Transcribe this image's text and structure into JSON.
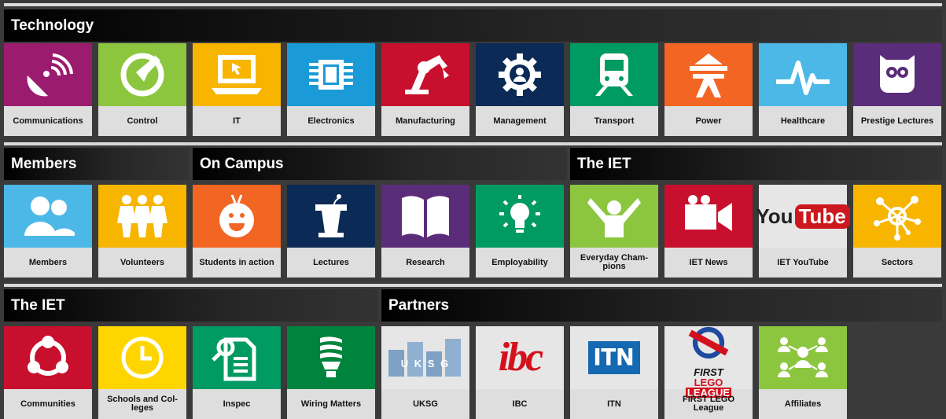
{
  "rows": [
    {
      "sections": [
        {
          "title": "Technology"
        }
      ],
      "tiles": [
        {
          "label": "Communications",
          "color": "#9b1b6e",
          "icon": "satellite-dish-icon"
        },
        {
          "label": "Control",
          "color": "#8cc63f",
          "icon": "gauge-icon"
        },
        {
          "label": "IT",
          "color": "#f7b500",
          "icon": "laptop-icon"
        },
        {
          "label": "Electronics",
          "color": "#1a9ad6",
          "icon": "chip-icon"
        },
        {
          "label": "Manufacturing",
          "color": "#c8102e",
          "icon": "robot-arm-icon"
        },
        {
          "label": "Management",
          "color": "#0b2a55",
          "icon": "gear-person-icon"
        },
        {
          "label": "Transport",
          "color": "#009a63",
          "icon": "train-icon"
        },
        {
          "label": "Power",
          "color": "#f26522",
          "icon": "pylon-icon"
        },
        {
          "label": "Healthcare",
          "color": "#4bb8e8",
          "icon": "heartbeat-icon"
        },
        {
          "label": "Prestige Lectures",
          "color": "#5b2c7a",
          "icon": "owl-icon"
        }
      ]
    },
    {
      "sections": [
        {
          "title": "Members"
        },
        {
          "title": "On Campus"
        },
        {
          "title": "The IET"
        }
      ],
      "tiles": [
        {
          "label": "Members",
          "color": "#4bb8e8",
          "icon": "people-icon"
        },
        {
          "label": "Volunteers",
          "color": "#f7b500",
          "icon": "volunteers-icon"
        },
        {
          "label": "Students in action",
          "color": "#f26522",
          "icon": "student-mascot-icon"
        },
        {
          "label": "Lectures",
          "color": "#0b2a55",
          "icon": "lectern-icon"
        },
        {
          "label": "Research",
          "color": "#5b2c7a",
          "icon": "open-book-icon"
        },
        {
          "label": "Employability",
          "color": "#009a63",
          "icon": "lightbulb-icon"
        },
        {
          "label": "Everyday Cham-pions",
          "color": "#8cc63f",
          "icon": "champion-icon"
        },
        {
          "label": "IET News",
          "color": "#c8102e",
          "icon": "video-camera-icon"
        },
        {
          "label": "IET YouTube",
          "color": "#e6e6e6",
          "icon": "youtube-icon"
        },
        {
          "label": "Sectors",
          "color": "#f7b500",
          "icon": "network-icon"
        }
      ]
    },
    {
      "sections": [
        {
          "title": "The IET"
        },
        {
          "title": "Partners"
        }
      ],
      "tiles": [
        {
          "label": "Communities",
          "color": "#c8102e",
          "icon": "communities-icon"
        },
        {
          "label": "Schools and Col-leges",
          "color": "#ffd500",
          "icon": "clock-icon"
        },
        {
          "label": "Inspec",
          "color": "#009a63",
          "icon": "document-search-icon"
        },
        {
          "label": "Wiring Matters",
          "color": "#00843d",
          "icon": "energy-bulb-icon"
        },
        {
          "label": "UKSG",
          "color": "#e6e6e6",
          "icon": "uksg-logo"
        },
        {
          "label": "IBC",
          "color": "#e6e6e6",
          "icon": "ibc-logo"
        },
        {
          "label": "ITN",
          "color": "#e6e6e6",
          "icon": "itn-logo"
        },
        {
          "label": "FIRST LEGO League",
          "color": "#e6e6e6",
          "icon": "first-lego-league-logo"
        },
        {
          "label": "Affiliates",
          "color": "#8cc63f",
          "icon": "affiliates-icon"
        }
      ]
    }
  ],
  "logos": {
    "uksg": "U K S G",
    "ibc": "ibc",
    "itn": "ITN",
    "youtube_you": "You",
    "youtube_tube": "Tube",
    "fll_first": "FIRST",
    "fll_lego": "LEGO",
    "fll_league": "LEAGUE"
  }
}
